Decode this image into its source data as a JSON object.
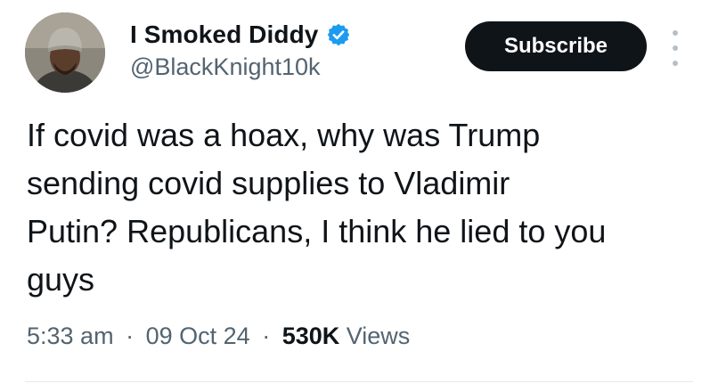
{
  "author": {
    "display_name": "I Smoked Diddy",
    "handle": "@BlackKnight10k",
    "verified_badge_icon": "verified-check-icon",
    "verified_color": "#1d9bf0",
    "avatar_icon": "profile-photo"
  },
  "actions": {
    "subscribe_label": "Subscribe",
    "more_icon": "more-vertical-icon"
  },
  "post": {
    "text_lines": [
      "If covid was a hoax, why was Trump",
      "sending covid supplies to Vladimir",
      "Putin? Republicans, I think he lied to you",
      "guys"
    ]
  },
  "meta": {
    "time": "5:33 am",
    "separator": "·",
    "date": "09 Oct 24",
    "views_count": "530K",
    "views_label": "Views"
  },
  "colors": {
    "text_primary": "#0f1419",
    "text_secondary": "#536471",
    "button_bg": "#0f1419"
  }
}
